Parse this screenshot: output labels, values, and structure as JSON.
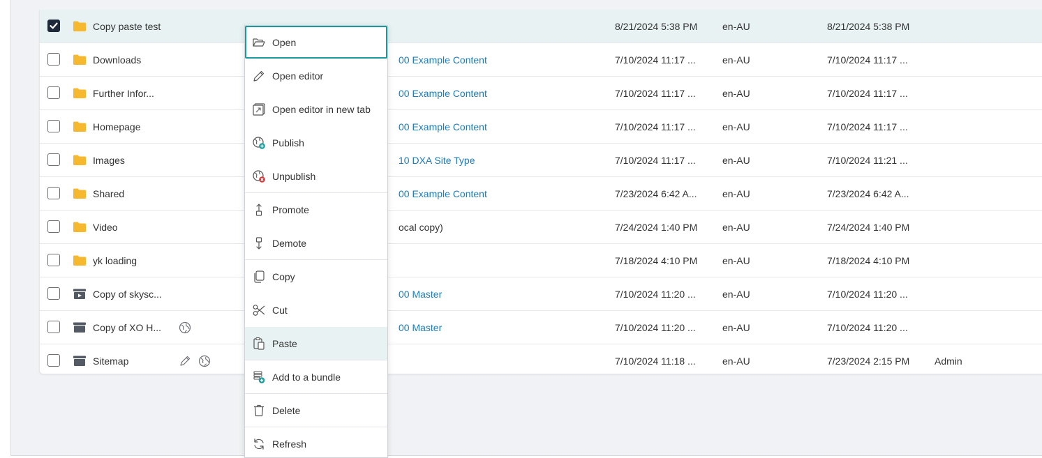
{
  "colors": {
    "accent_teal": "#1a9a9a",
    "link_blue": "#1f7bb6",
    "folder_yellow": "#f5b82e",
    "selected_row": "#e8f2f2"
  },
  "rows": [
    {
      "name": "Copy paste test",
      "checked": true,
      "icon": "folder-icon",
      "col2": "",
      "col2_link": false,
      "date1": "8/21/2024 5:38 PM",
      "lang": "en-AU",
      "date2": "8/21/2024 5:38 PM",
      "user": ""
    },
    {
      "name": "Downloads",
      "checked": false,
      "icon": "folder-icon",
      "col2": "00 Example Content",
      "col2_link": true,
      "date1": "7/10/2024 11:17 ...",
      "lang": "en-AU",
      "date2": "7/10/2024 11:17 ...",
      "user": ""
    },
    {
      "name": "Further Infor...",
      "checked": false,
      "icon": "folder-icon",
      "col2": "00 Example Content",
      "col2_link": true,
      "date1": "7/10/2024 11:17 ...",
      "lang": "en-AU",
      "date2": "7/10/2024 11:17 ...",
      "user": ""
    },
    {
      "name": "Homepage",
      "checked": false,
      "icon": "folder-icon",
      "col2": "00 Example Content",
      "col2_link": true,
      "date1": "7/10/2024 11:17 ...",
      "lang": "en-AU",
      "date2": "7/10/2024 11:17 ...",
      "user": ""
    },
    {
      "name": "Images",
      "checked": false,
      "icon": "folder-icon",
      "col2": "10 DXA Site Type",
      "col2_link": true,
      "date1": "7/10/2024 11:17 ...",
      "lang": "en-AU",
      "date2": "7/10/2024 11:21 ...",
      "user": ""
    },
    {
      "name": "Shared",
      "checked": false,
      "icon": "folder-icon",
      "col2": "00 Example Content",
      "col2_link": true,
      "date1": "7/23/2024 6:42 A...",
      "lang": "en-AU",
      "date2": "7/23/2024 6:42 A...",
      "user": ""
    },
    {
      "name": "Video",
      "checked": false,
      "icon": "folder-icon",
      "col2": "ocal copy)",
      "col2_link": false,
      "date1": "7/24/2024 1:40 PM",
      "lang": "en-AU",
      "date2": "7/24/2024 1:40 PM",
      "user": ""
    },
    {
      "name": "yk loading",
      "checked": false,
      "icon": "folder-icon",
      "col2": "",
      "col2_link": false,
      "date1": "7/18/2024 4:10 PM",
      "lang": "en-AU",
      "date2": "7/18/2024 4:10 PM",
      "user": ""
    },
    {
      "name": "Copy of skysc...",
      "checked": false,
      "icon": "page-type-icon",
      "col2": "00 Master",
      "col2_link": true,
      "date1": "7/10/2024 11:20 ...",
      "lang": "en-AU",
      "date2": "7/10/2024 11:20 ...",
      "user": ""
    },
    {
      "name": "Copy of XO H...",
      "checked": false,
      "icon": "structure-group-icon",
      "col2": "00 Master",
      "col2_link": true,
      "date1": "7/10/2024 11:20 ...",
      "lang": "en-AU",
      "date2": "7/10/2024 11:20 ...",
      "user": ""
    },
    {
      "name": "Sitemap",
      "checked": false,
      "icon": "structure-group-icon",
      "col2": "",
      "col2_link": false,
      "date1": "7/10/2024 11:18 ...",
      "lang": "en-AU",
      "date2": "7/23/2024 2:15 PM",
      "user": "Admin"
    }
  ],
  "context_menu": {
    "items": [
      {
        "label": "Open",
        "icon": "folder-open-icon"
      },
      {
        "label": "Open editor",
        "icon": "pencil-icon"
      },
      {
        "label": "Open editor in new tab",
        "icon": "new-tab-icon"
      },
      {
        "label": "Publish",
        "icon": "publish-globe-icon"
      },
      {
        "label": "Unpublish",
        "icon": "unpublish-globe-icon"
      },
      {
        "label": "Promote",
        "icon": "promote-icon"
      },
      {
        "label": "Demote",
        "icon": "demote-icon"
      },
      {
        "label": "Copy",
        "icon": "copy-icon"
      },
      {
        "label": "Cut",
        "icon": "scissors-icon"
      },
      {
        "label": "Paste",
        "icon": "paste-icon"
      },
      {
        "label": "Add to a bundle",
        "icon": "add-bundle-icon"
      },
      {
        "label": "Delete",
        "icon": "trash-icon"
      },
      {
        "label": "Refresh",
        "icon": "refresh-icon"
      }
    ]
  }
}
